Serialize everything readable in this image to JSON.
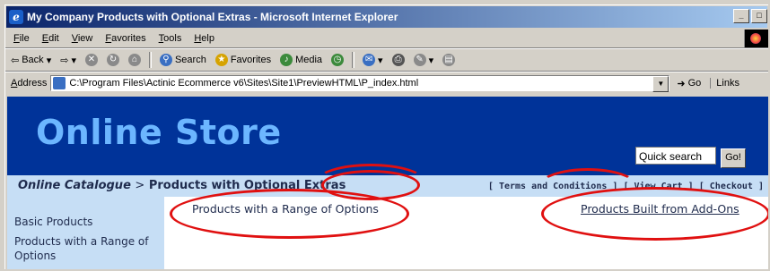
{
  "window": {
    "title": "My Company Products with Optional Extras - Microsoft Internet Explorer"
  },
  "menu": [
    "File",
    "Edit",
    "View",
    "Favorites",
    "Tools",
    "Help"
  ],
  "toolbar": {
    "back": "Back",
    "search": "Search",
    "favorites": "Favorites",
    "media": "Media"
  },
  "address": {
    "label": "Address",
    "url": "C:\\Program Files\\Actinic Ecommerce v6\\Sites\\Site1\\PreviewHTML\\P_index.html",
    "go": "Go",
    "links": "Links"
  },
  "page": {
    "store_title": "Online Store",
    "quick_search": "Quick search",
    "go_button": "Go!",
    "crumb_root": "Online Catalogue",
    "crumb_sep": ">",
    "crumb_current": "Products with Optional Extras",
    "top_links": {
      "terms": "[ Terms and Conditions ]",
      "cart": "[ View Cart ]",
      "checkout": "[ Checkout ]"
    },
    "sidebar": [
      "Basic Products",
      "Products with a Range of Options"
    ],
    "main_links": {
      "range": "Products with a Range of Options",
      "addons": "Products Built from Add-Ons"
    }
  },
  "colors": {
    "banner": "#003399",
    "store_title": "#6cb6ff",
    "nav_bg": "#c6def5",
    "highlight_oval": "#e01010"
  }
}
